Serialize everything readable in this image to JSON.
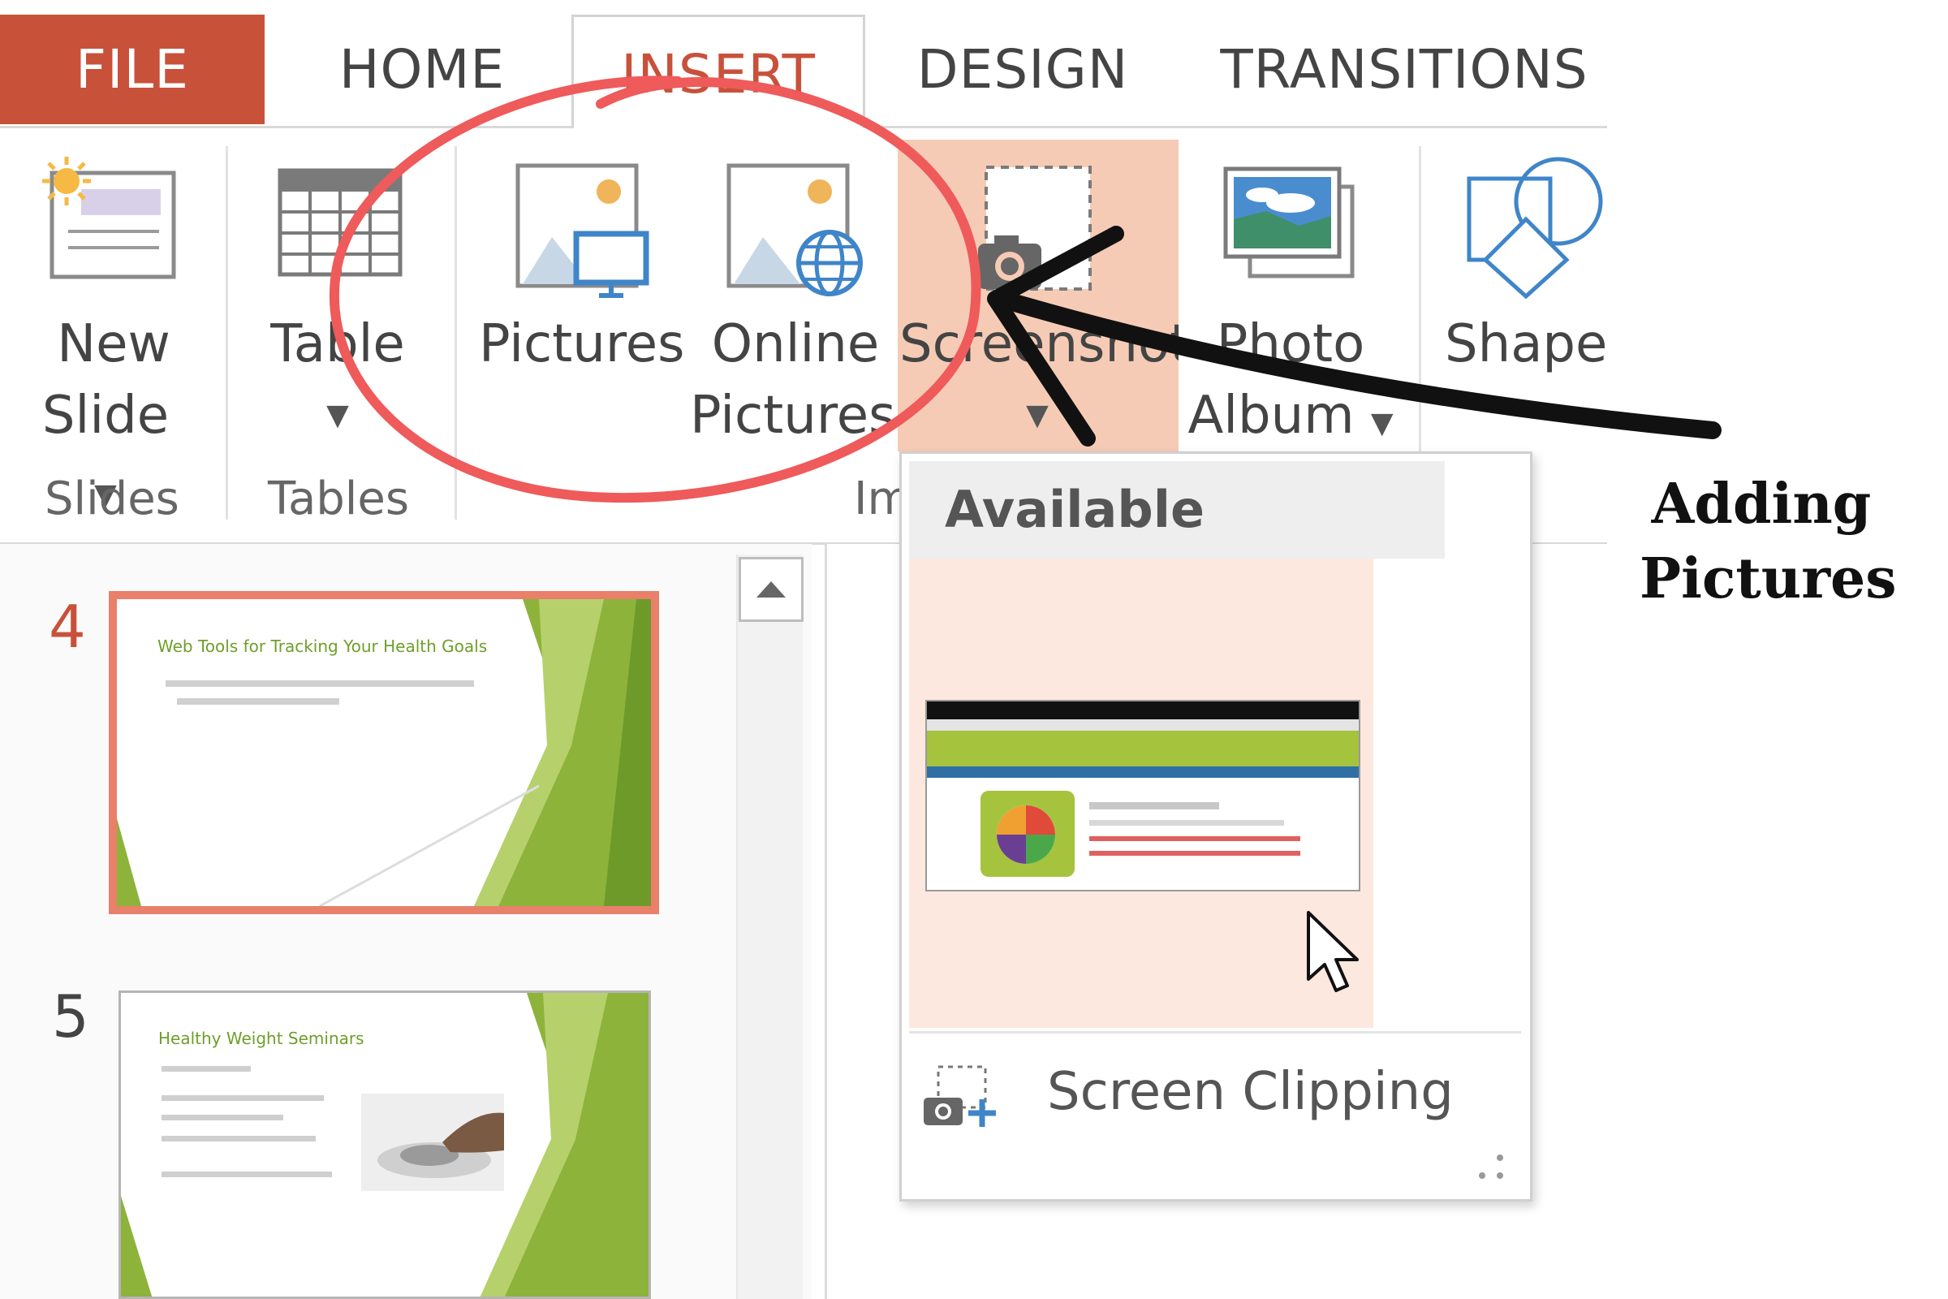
{
  "tabs": {
    "file": "FILE",
    "home": "HOME",
    "insert": "INSERT",
    "design": "DESIGN",
    "transitions": "TRANSITIONS"
  },
  "ribbon": {
    "new_slide_1": "New",
    "new_slide_2": "Slide",
    "table": "Table",
    "pictures": "Pictures",
    "online_pictures_1": "Online",
    "online_pictures_2": "Pictures",
    "screenshot": "Screenshot",
    "photo_album_1": "Photo",
    "photo_album_2": "Album",
    "shapes": "Shapes",
    "group_slides": "Slides",
    "group_tables": "Tables",
    "group_images": "Images"
  },
  "slides": [
    {
      "number": "4",
      "title": "Web Tools for Tracking Your Health Goals"
    },
    {
      "number": "5",
      "title": "Healthy Weight Seminars"
    }
  ],
  "dropdown": {
    "header": "Available Windows",
    "screen_clipping": "Screen Clipping"
  },
  "annotation": {
    "line1": "Adding",
    "line2": "Pictures"
  },
  "colors": {
    "accent": "#c8513a",
    "highlight": "#f6cbb5",
    "circle": "#ef5a5a",
    "slide_green": "#8db33a"
  }
}
